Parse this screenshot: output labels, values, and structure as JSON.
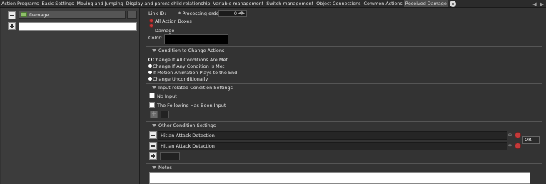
{
  "tabs": [
    {
      "label": "Action Programs",
      "active": false
    },
    {
      "label": "Basic Settings",
      "active": false
    },
    {
      "label": "Moving and Jumping",
      "active": false
    },
    {
      "label": "Display and parent-child relationship",
      "active": false
    },
    {
      "label": "Variable management",
      "active": false
    },
    {
      "label": "Switch management",
      "active": false
    },
    {
      "label": "Object Connections",
      "active": false
    },
    {
      "label": "Common Actions",
      "active": false
    },
    {
      "label": "Received Damage",
      "active": true
    }
  ],
  "left_panel": {
    "list_item_label": "Damage"
  },
  "header": {
    "link_id_label": "Link ID:",
    "link_id_value": "---",
    "processing_order_label": "* Processing order:",
    "processing_order_value": "0",
    "all_action_boxes_label": "All Action Boxes",
    "damage_label": "Damage",
    "color_label": "Color:"
  },
  "condition_section": {
    "title": "Condition to Change Actions",
    "options": [
      "Change If All Conditions Are Met",
      "Change If Any Condition Is Met",
      "If Motion Animation Plays to the End",
      "Change Unconditionally"
    ],
    "selected_index": 0
  },
  "input_section": {
    "title": "Input-related Condition Settings",
    "no_input_label": "No Input",
    "following_input_label": "The Following Has Been Input"
  },
  "other_section": {
    "title": "Other Condition Settings",
    "conditions": [
      "Hit an Attack Detection",
      "Hit an Attack Detection"
    ],
    "operator": "OR"
  },
  "notes_section": {
    "title": "Notes"
  },
  "colors": {
    "accent_red": "#c43a3a",
    "panel_bg": "#333333"
  }
}
